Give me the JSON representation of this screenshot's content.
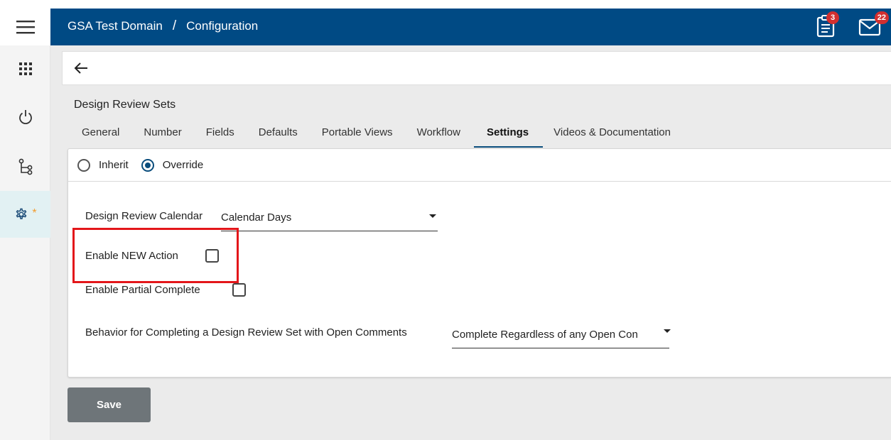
{
  "header": {
    "domain": "GSA Test Domain",
    "separator": "/",
    "page": "Configuration",
    "tasks_badge": "3",
    "messages_badge": "22"
  },
  "rail": {
    "items": [
      "apps-icon",
      "power-icon",
      "workflow-icon",
      "settings-icon"
    ],
    "active_marker": "*"
  },
  "main": {
    "section_title": "Design Review Sets",
    "tabs": [
      {
        "label": "General"
      },
      {
        "label": "Number"
      },
      {
        "label": "Fields"
      },
      {
        "label": "Defaults"
      },
      {
        "label": "Portable Views"
      },
      {
        "label": "Workflow"
      },
      {
        "label": "Settings"
      },
      {
        "label": "Videos & Documentation"
      }
    ],
    "active_tab": "Settings",
    "inherit_mode": {
      "inherit_label": "Inherit",
      "override_label": "Override",
      "selected": "Override"
    },
    "calendar": {
      "label": "Design Review Calendar",
      "value": "Calendar Days"
    },
    "enable_new_action": {
      "label": "Enable NEW Action",
      "checked": false
    },
    "enable_partial_complete": {
      "label": "Enable Partial Complete",
      "checked": false
    },
    "open_comments_behavior": {
      "label": "Behavior for Completing a Design Review Set with Open Comments",
      "value": "Complete Regardless of any Open Con"
    },
    "save_label": "Save"
  },
  "colors": {
    "header_bg": "#004a84",
    "accent": "#0a4d7c",
    "highlight_border": "#e3161a",
    "badge": "#d32f2f",
    "save_bg": "#6e7579",
    "rail_active": "#e2f1f3",
    "marker": "#f39c2e"
  }
}
